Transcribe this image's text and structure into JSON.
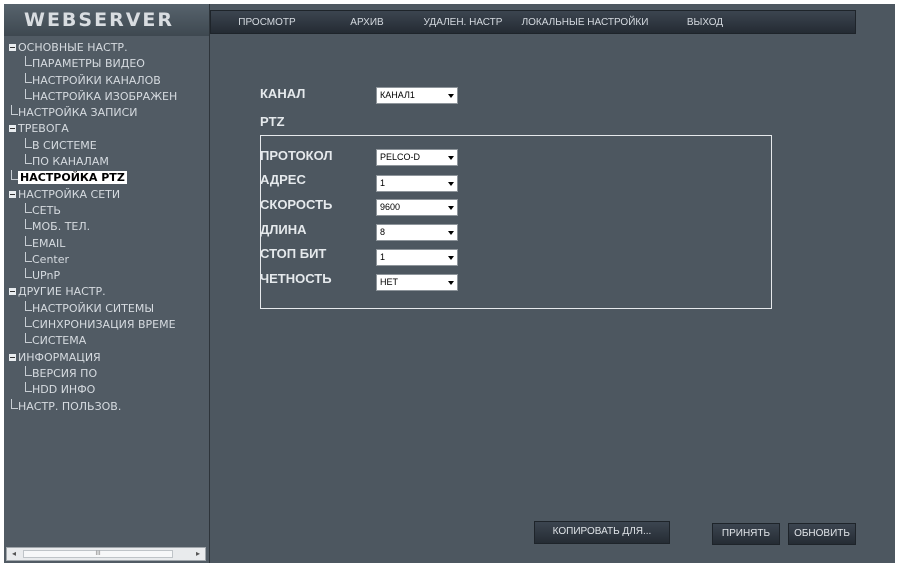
{
  "brand": "WEBSERVER",
  "nav": [
    "ПРОСМОТР",
    "АРХИВ",
    "УДАЛЕН. НАСТР",
    "ЛОКАЛЬНЫЕ НАСТРОЙКИ",
    "ВЫХОД"
  ],
  "tree": [
    "ОСНОВНЫЕ НАСТР.",
    "ПАРАМЕТРЫ ВИДЕО",
    "НАСТРОЙКИ КАНАЛОВ",
    "НАСТРОЙКА ИЗОБРАЖЕН",
    "НАСТРОЙКА ЗАПИСИ",
    "ТРЕВОГА",
    "В СИСТЕМЕ",
    "ПО КАНАЛАМ",
    "НАСТРОЙКА PTZ",
    "НАСТРОЙКА СЕТИ",
    "СЕТЬ",
    "МОБ. ТЕЛ.",
    "EMAIL",
    "Center",
    "UPnP",
    "ДРУГИЕ НАСТР.",
    "НАСТРОЙКИ СИТЕМЫ",
    "СИНХРОНИЗАЦИЯ ВРЕМЕ",
    "СИСТЕМА",
    "ИНФОРМАЦИЯ",
    "ВЕРСИЯ ПО",
    "HDD ИНФО",
    "НАСТР. ПОЛЬЗОВ."
  ],
  "scrollbar": {
    "left_arrow": "◂",
    "right_arrow": "▸",
    "grip": "III"
  },
  "form": {
    "channel_label": "КАНАЛ",
    "channel_value": "КАНАЛ1",
    "ptz_label": "PTZ",
    "protocol_label": "ПРОТОКОЛ",
    "protocol_value": "PELCO-D",
    "address_label": "АДРЕС",
    "address_value": "1",
    "speed_label": "СКОРОСТЬ",
    "speed_value": "9600",
    "length_label": "ДЛИНА",
    "length_value": "8",
    "stopbit_label": "СТОП БИТ",
    "stopbit_value": "1",
    "parity_label": "ЧЕТНОСТЬ",
    "parity_value": "НЕТ"
  },
  "buttons": {
    "copy": "КОПИРОВАТЬ ДЛЯ...",
    "apply": "ПРИНЯТЬ",
    "refresh": "ОБНОВИТЬ"
  },
  "colors": {
    "background": "#4d5760",
    "sidebar": "#515b64",
    "nav": "#2b333b",
    "highlight": "#ffffff"
  }
}
